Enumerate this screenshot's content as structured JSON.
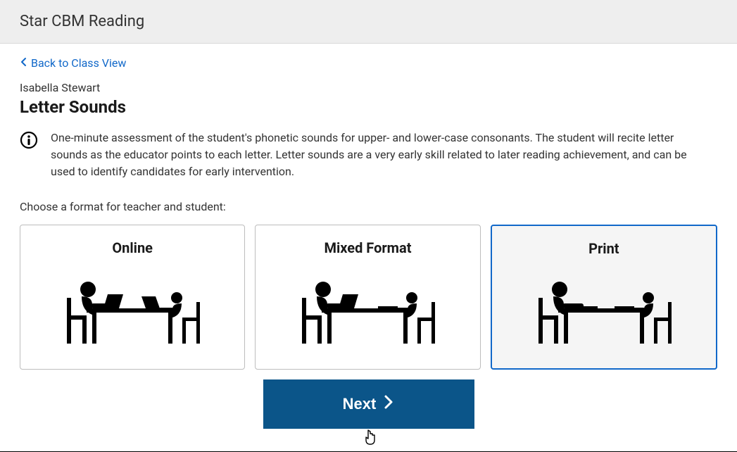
{
  "header": {
    "app_title": "Star CBM Reading"
  },
  "nav": {
    "back_label": "Back to Class View"
  },
  "student": {
    "name": "Isabella Stewart"
  },
  "assessment": {
    "title": "Letter Sounds",
    "description": "One-minute assessment of the student's phonetic sounds for upper- and lower-case consonants. The student will recite letter sounds as the educator points to each letter. Letter sounds are a very early skill related to later reading achievement, and can be used to identify candidates for early intervention."
  },
  "format_section": {
    "prompt": "Choose a format for teacher and student:",
    "options": [
      {
        "id": "online",
        "label": "Online",
        "teacher_device": "laptop",
        "student_device": "laptop",
        "selected": false
      },
      {
        "id": "mixed",
        "label": "Mixed Format",
        "teacher_device": "laptop",
        "student_device": "paper",
        "selected": false
      },
      {
        "id": "print",
        "label": "Print",
        "teacher_device": "paper",
        "student_device": "paper",
        "selected": true
      }
    ]
  },
  "actions": {
    "next_label": "Next"
  },
  "colors": {
    "accent": "#1168c9",
    "primary_button": "#0b5589",
    "header_bg": "#eeeeee"
  },
  "icons": {
    "info": "info-circle-icon",
    "back_chevron": "chevron-left-icon",
    "next_chevron": "chevron-right-icon"
  }
}
